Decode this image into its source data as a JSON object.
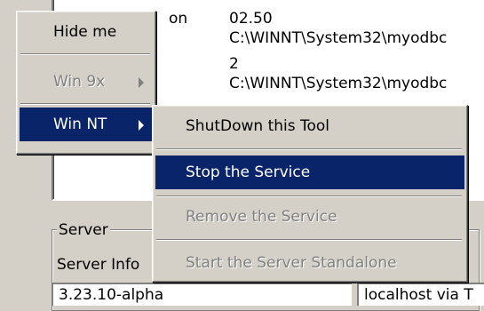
{
  "info_rows": [
    {
      "name": "on",
      "value": "02.50"
    },
    {
      "name": "",
      "value": "C:\\WINNT\\System32\\myodbc"
    },
    {
      "name": "",
      "value": "2"
    },
    {
      "name": "",
      "value": "C:\\WINNT\\System32\\myodbc"
    }
  ],
  "server_group": {
    "label": "Server",
    "info_label": "Server Info",
    "field_left": "3.23.10-alpha",
    "field_right": "localhost via T"
  },
  "main_menu": {
    "items": [
      {
        "label": "Hide me",
        "state": "normal"
      },
      {
        "label": "Win 9x",
        "state": "disabled",
        "submenu": true
      },
      {
        "label": "Win NT",
        "state": "selected",
        "submenu": true
      }
    ]
  },
  "submenu": {
    "items": [
      {
        "label": "ShutDown this Tool",
        "state": "normal"
      },
      {
        "label": "Stop the Service",
        "state": "selected"
      },
      {
        "label": "Remove the Service",
        "state": "disabled"
      },
      {
        "label": "Start the Server Standalone",
        "state": "disabled"
      }
    ]
  },
  "colors": {
    "highlight": "#0a246a",
    "face": "#d4d0c8",
    "disabled": "#808080"
  }
}
